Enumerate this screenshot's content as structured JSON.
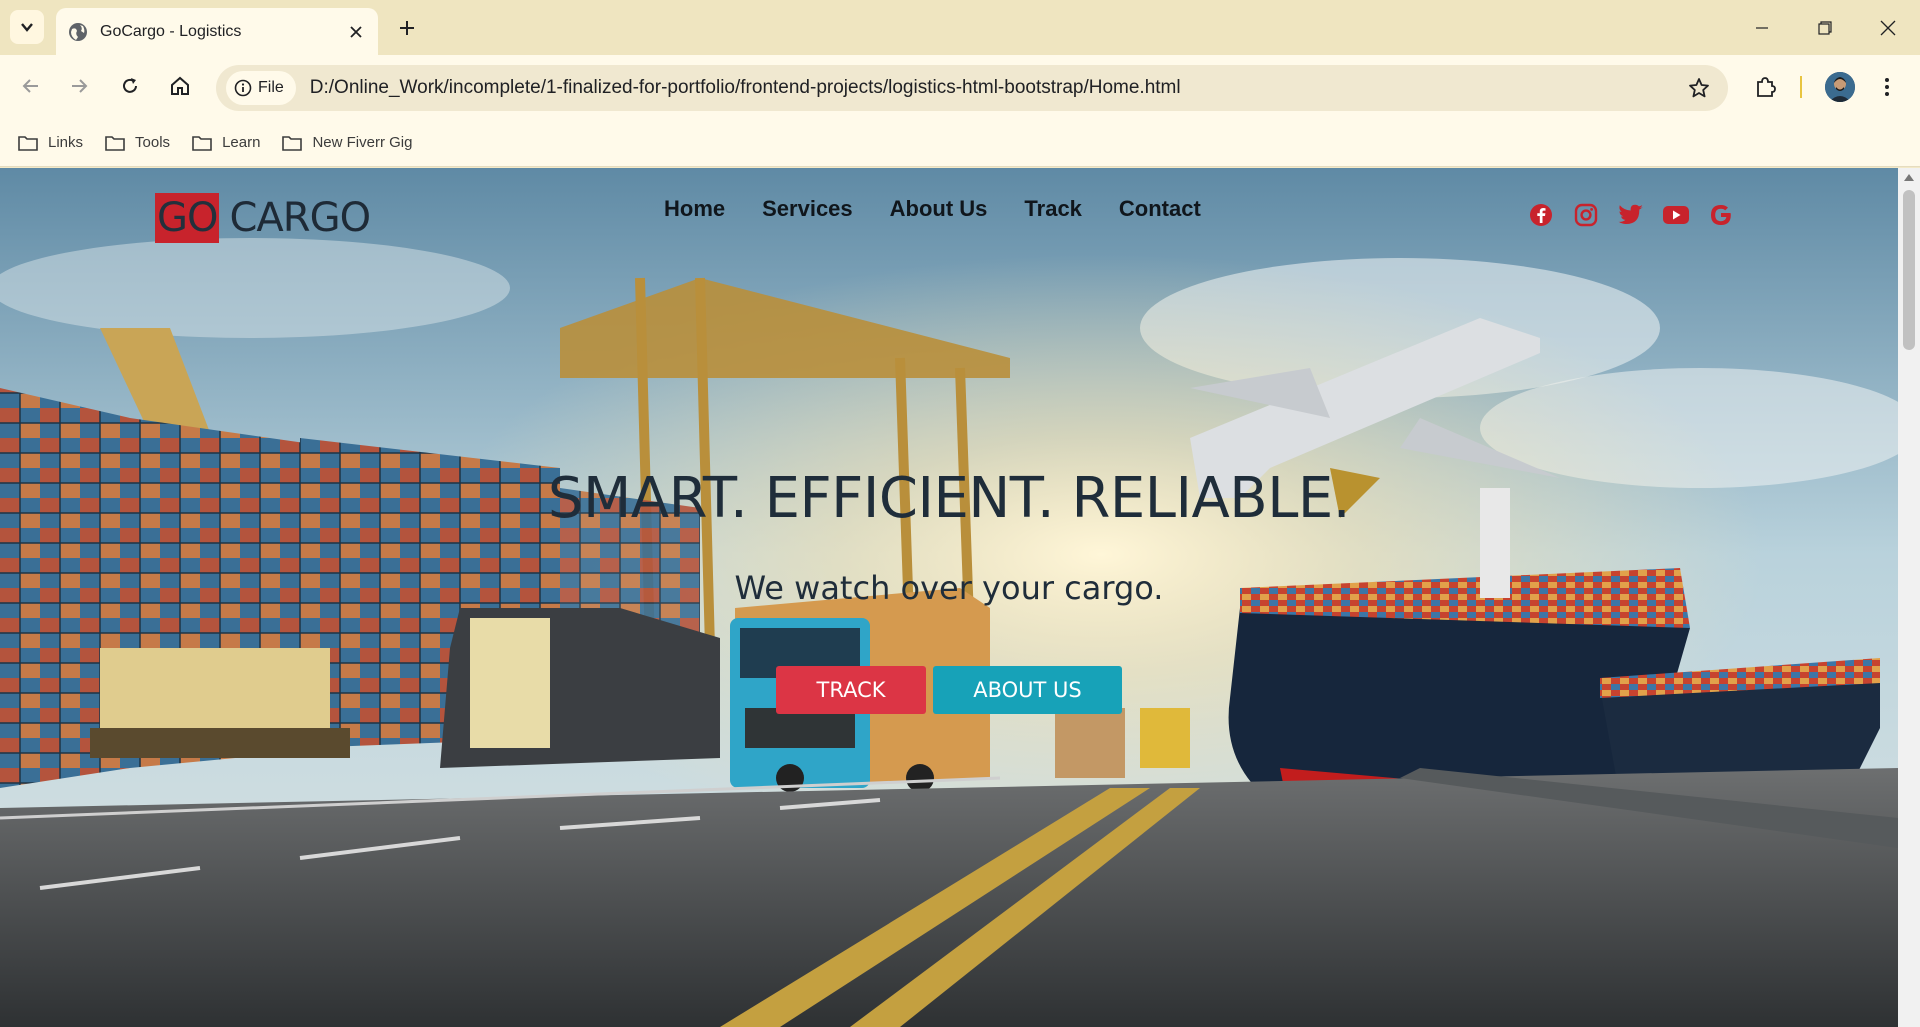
{
  "browser": {
    "tab_title": "GoCargo - Logistics",
    "url_chip": "File",
    "url": "D:/Online_Work/incomplete/1-finalized-for-portfolio/frontend-projects/logistics-html-bootstrap/Home.html",
    "bookmarks": [
      "Links",
      "Tools",
      "Learn",
      "New Fiverr Gig"
    ]
  },
  "site": {
    "logo_go": "GO",
    "logo_cargo": "CARGO",
    "nav": [
      "Home",
      "Services",
      "About Us",
      "Track",
      "Contact"
    ],
    "social_icons": [
      "facebook-icon",
      "instagram-icon",
      "twitter-icon",
      "youtube-icon",
      "google-icon"
    ],
    "headline": "SMART. EFFICIENT. RELIABLE.",
    "subheadline": "We watch over your cargo.",
    "buttons": {
      "track": "TRACK",
      "about": "ABOUT US"
    }
  },
  "colors": {
    "accent_red": "#dc3545",
    "accent_teal": "#17a2b8",
    "logo_red": "#c8232c",
    "social_red": "#c8232c",
    "chrome_bg": "#efe5c0"
  }
}
